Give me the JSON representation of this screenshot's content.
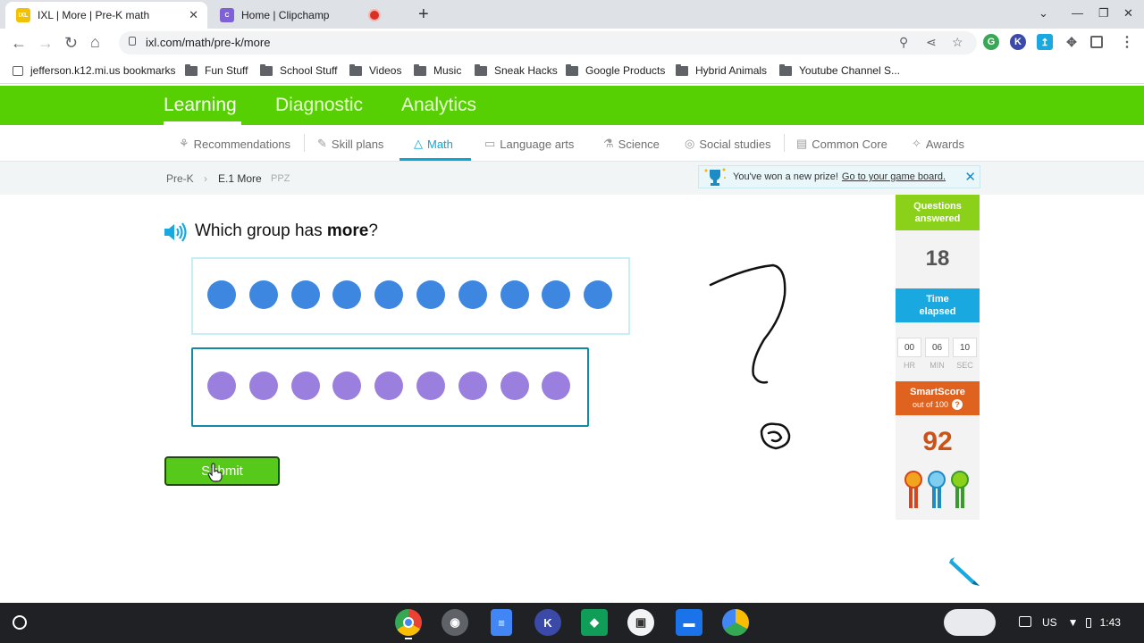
{
  "browser": {
    "tabs": [
      {
        "title": "IXL | More | Pre-K math",
        "active": true,
        "favicon": "IXL"
      },
      {
        "title": "Home | Clipchamp",
        "active": false,
        "recording": true
      }
    ],
    "url": "ixl.com/math/pre-k/more",
    "bookmarks": [
      "jefferson.k12.mi.us bookmarks",
      "Fun Stuff",
      "School Stuff",
      "Videos",
      "Music",
      "Sneak Hacks",
      "Google Products",
      "Hybrid Animals",
      "Youtube Channel S..."
    ]
  },
  "ixl": {
    "main_nav": [
      "Learning",
      "Diagnostic",
      "Analytics"
    ],
    "sub_nav": [
      "Recommendations",
      "Skill plans",
      "Math",
      "Language arts",
      "Science",
      "Social studies",
      "Common Core",
      "Awards"
    ],
    "breadcrumb": {
      "grade": "Pre-K",
      "skill": "E.1 More",
      "code": "PPZ"
    },
    "prize": {
      "text": "You've won a new prize!",
      "link": "Go to your game board."
    },
    "question": {
      "prefix": "Which group has ",
      "bold": "more",
      "suffix": "?"
    },
    "groups": [
      {
        "color": "#3d87e0",
        "count": 10
      },
      {
        "color": "#9a7fdf",
        "count": 9
      }
    ],
    "submit_label": "Submit",
    "stats": {
      "questions_label": "Questions answered",
      "questions_value": "18",
      "time_label": "Time elapsed",
      "hr": "00",
      "min": "06",
      "sec": "10",
      "hr_label": "HR",
      "min_label": "MIN",
      "sec_label": "SEC",
      "smartscore_label": "SmartScore",
      "smartscore_sub": "out of 100",
      "smartscore_value": "92"
    }
  },
  "taskbar": {
    "locale": "US",
    "time": "1:43"
  },
  "colors": {
    "ixl_green": "#56d003",
    "ixl_blue": "#0aa6d6",
    "smartscore_orange": "#e0621f",
    "questions_green": "#8bd11a"
  }
}
